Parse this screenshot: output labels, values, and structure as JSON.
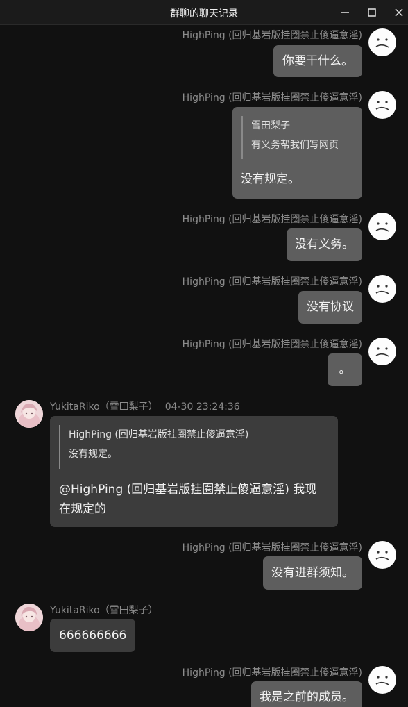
{
  "window": {
    "title": "群聊的聊天记录",
    "controls": {
      "minimize": "minimize-icon",
      "maximize": "maximize-icon",
      "close": "close-icon"
    }
  },
  "messages": [
    {
      "sender": "HighPing (回归基岩版挂圈禁止傻逼意淫)",
      "text": "你要干什么。",
      "side": "right"
    },
    {
      "sender": "HighPing (回归基岩版挂圈禁止傻逼意淫)",
      "quote_author": "雪田梨子",
      "quote_text": "有义务帮我们写网页",
      "text": "没有规定。",
      "side": "right"
    },
    {
      "sender": "HighPing (回归基岩版挂圈禁止傻逼意淫)",
      "text": "没有义务。",
      "side": "right"
    },
    {
      "sender": "HighPing (回归基岩版挂圈禁止傻逼意淫)",
      "text": "没有协议",
      "side": "right"
    },
    {
      "sender": "HighPing (回归基岩版挂圈禁止傻逼意淫)",
      "text": "。",
      "side": "right"
    },
    {
      "sender": "YukitaRiko（雪田梨子）",
      "time": "04-30 23:24:36",
      "quote_author": "HighPing (回归基岩版挂圈禁止傻逼意淫)",
      "quote_text": "没有规定。",
      "text_line1": "@HighPing (回归基岩版挂圈禁止傻逼意淫) 我现",
      "text_line2": "在规定的",
      "side": "left"
    },
    {
      "sender": "HighPing (回归基岩版挂圈禁止傻逼意淫)",
      "text": "没有进群须知。",
      "side": "right"
    },
    {
      "sender": "YukitaRiko（雪田梨子）",
      "text": "666666666",
      "side": "left"
    },
    {
      "sender": "HighPing (回归基岩版挂圈禁止傻逼意淫)",
      "text": "我是之前的成员。",
      "side": "right"
    }
  ]
}
